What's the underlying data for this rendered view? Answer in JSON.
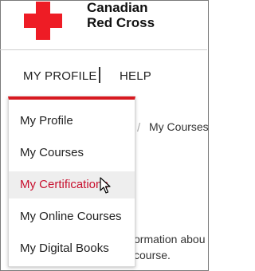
{
  "brand": {
    "line1": "Canadian",
    "line2": "Red Cross",
    "logo_color": "#ee1c25"
  },
  "nav": {
    "profile": "MY PROFILE",
    "help": "HELP"
  },
  "background": {
    "breadcrumb_sep": "/",
    "breadcrumb_current": "My Courses",
    "text_line1": "ormation abou",
    "text_line2": "course."
  },
  "dropdown": {
    "accent_color": "#d71920",
    "items": [
      {
        "label": "My Profile"
      },
      {
        "label": "My Courses"
      },
      {
        "label": "My Certifications",
        "state": "hover"
      },
      {
        "label": "My Online Courses"
      },
      {
        "label": "My Digital Books"
      }
    ]
  },
  "cursor": {
    "icon": "arrow-pointer-icon"
  }
}
